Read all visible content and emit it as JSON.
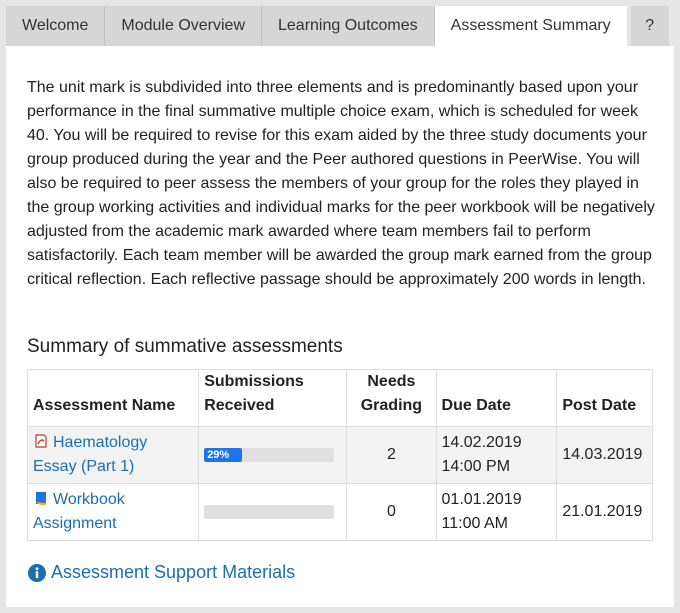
{
  "tabs": [
    {
      "label": "Welcome"
    },
    {
      "label": "Module Overview"
    },
    {
      "label": "Learning Outcomes"
    },
    {
      "label": "Assessment Summary"
    },
    {
      "label": "?"
    }
  ],
  "active_tab": "Assessment Summary",
  "intro_text": "The unit mark is subdivided into three elements and is predominantly based upon your performance in the final summative multiple choice exam, which is scheduled for week 40. You will be required to revise for this exam aided by the three study documents your group produced during the year and the Peer authored questions in PeerWise. You will also be required to peer assess the members of your group for the roles they played in the group working activities and individual marks for the peer workbook will be negatively adjusted from the academic mark awarded where team members fail to perform satisfactorily. Each team member will be awarded the group mark earned from the group critical reflection. Each reflective passage should be approximately 200 words in length.",
  "summary_heading": "Summary of summative assessments",
  "table": {
    "headers": {
      "name": "Assessment Name",
      "submissions": "Submissions Received",
      "grading": "Needs Grading",
      "due": "Due Date",
      "post": "Post Date"
    },
    "rows": [
      {
        "icon": "essay-icon",
        "name": "Haematology Essay (Part 1)",
        "progress_label": "29%",
        "progress_value": 0.29,
        "needs_grading": "2",
        "due_date": "14.02.2019",
        "due_time": "14:00 PM",
        "post_date": "14.03.2019"
      },
      {
        "icon": "workbook-icon",
        "name": "Workbook Assignment",
        "progress_label": "",
        "progress_value": 0,
        "needs_grading": "0",
        "due_date": "01.01.2019",
        "due_time": "11:00 AM",
        "post_date": "21.01.2019"
      }
    ]
  },
  "support_link": "Assessment Support Materials",
  "colors": {
    "link": "#1a6fb0",
    "progress_fill": "#1f73e8",
    "tab_inactive": "#d6d6d6",
    "background": "#e5e5e5"
  }
}
